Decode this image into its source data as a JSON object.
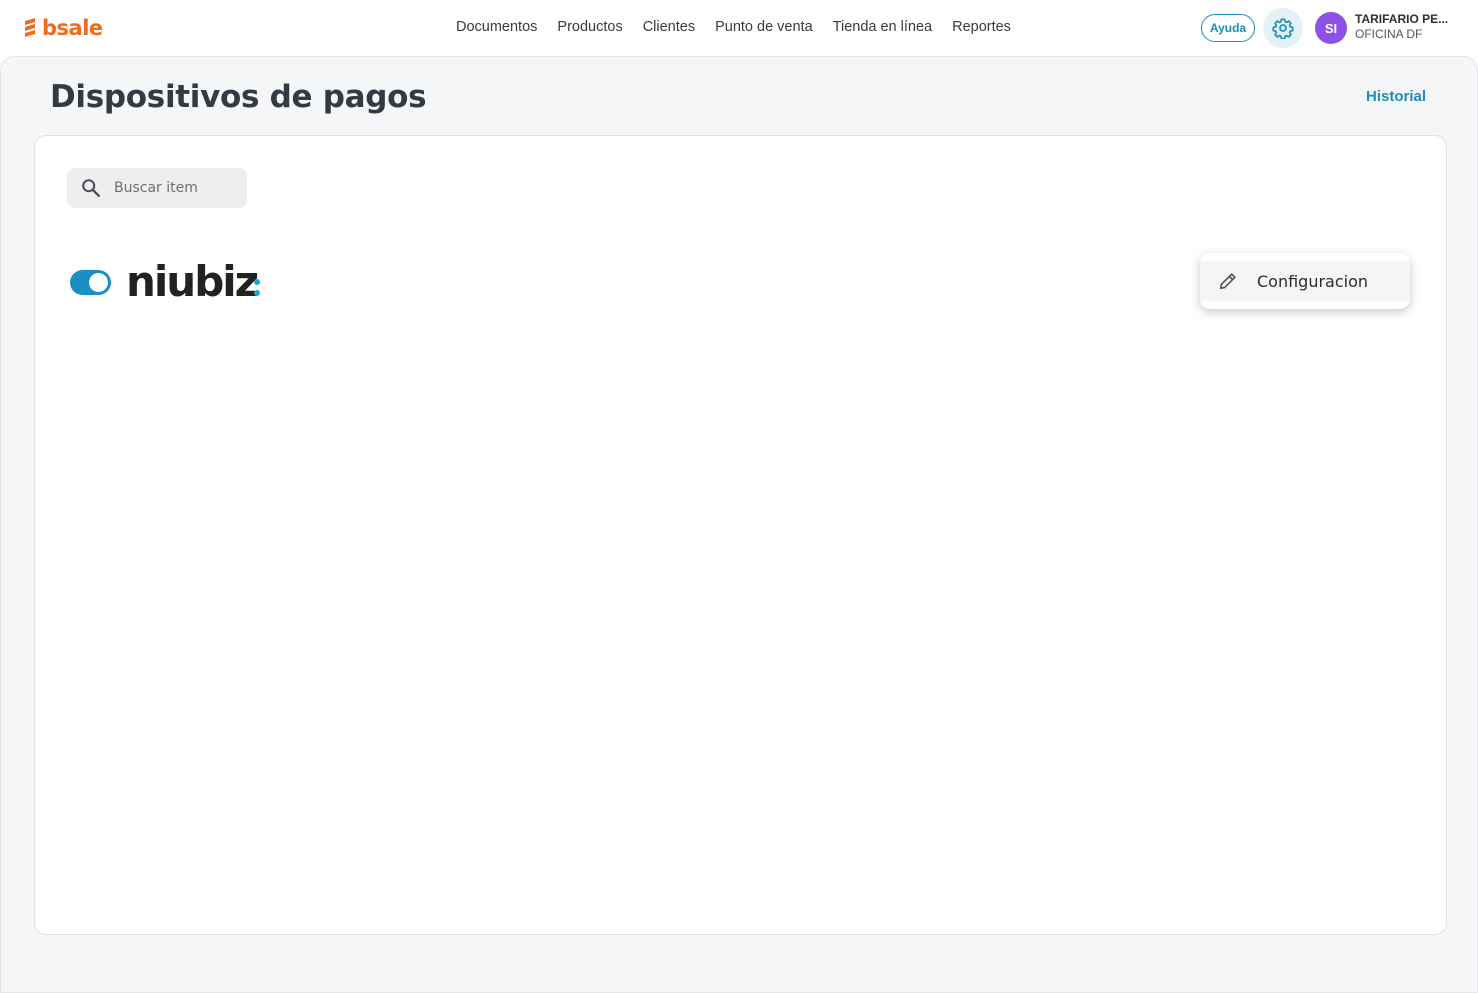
{
  "app": {
    "logo_text": "bsale",
    "brand_color": "#f26b1d",
    "accent_color": "#1a8fb7"
  },
  "nav": {
    "items": [
      {
        "label": "Documentos"
      },
      {
        "label": "Productos"
      },
      {
        "label": "Clientes"
      },
      {
        "label": "Punto de venta"
      },
      {
        "label": "Tienda en línea"
      },
      {
        "label": "Reportes"
      }
    ]
  },
  "header": {
    "help_label": "Ayuda",
    "settings_icon": "gear-icon",
    "avatar_initials": "SI",
    "avatar_color": "#8c52e6",
    "account_name": "TARIFARIO PE...",
    "account_office": "OFICINA DF"
  },
  "page": {
    "title": "Dispositivos de pagos",
    "history_label": "Historial"
  },
  "search": {
    "placeholder": "Buscar item",
    "value": "",
    "icon": "search-icon"
  },
  "devices": [
    {
      "brand": "niubiz",
      "brand_suffix": ":",
      "enabled": true,
      "toggle_color": "#1a8fc4"
    }
  ],
  "context_menu": {
    "items": [
      {
        "label": "Configuracion",
        "icon": "pencil-icon"
      }
    ]
  }
}
